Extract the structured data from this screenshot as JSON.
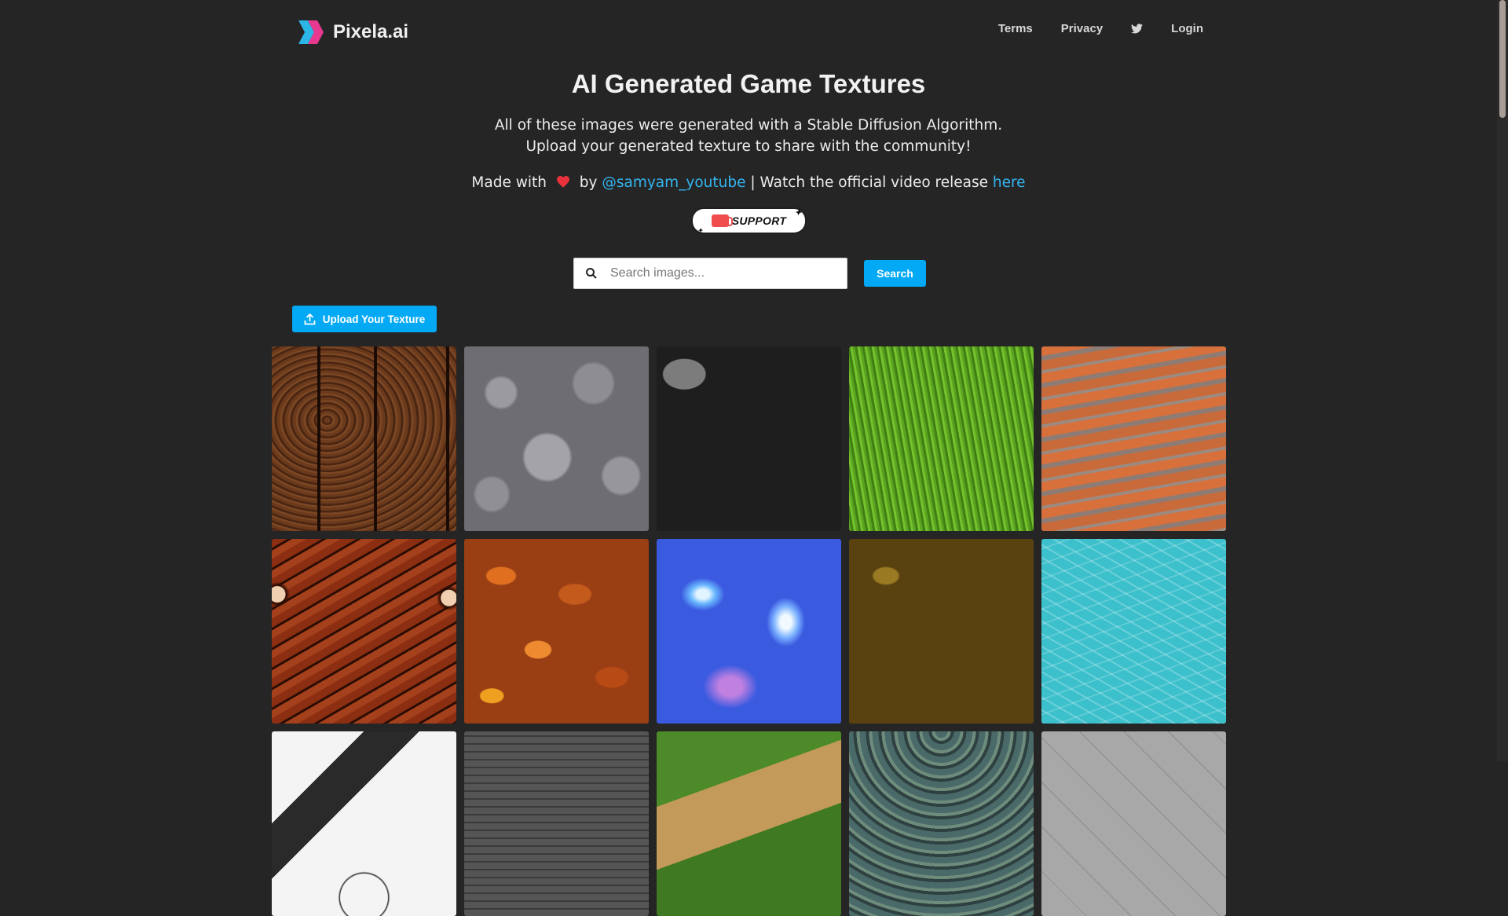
{
  "brand": {
    "name": "Pixela.ai"
  },
  "nav": {
    "terms": "Terms",
    "privacy": "Privacy",
    "login": "Login"
  },
  "hero": {
    "title": "AI Generated Game Textures",
    "description": "All of these images were generated with a Stable Diffusion Algorithm. Upload your generated texture to share with the community!",
    "credit_prefix": "Made with",
    "credit_by": "by",
    "credit_handle": "@samyam_youtube",
    "credit_middle": "| Watch the official video release",
    "credit_link": "here"
  },
  "support": {
    "label": "SUPPORT"
  },
  "search": {
    "placeholder": "Search images...",
    "value": "",
    "button": "Search"
  },
  "upload": {
    "label": "Upload Your Texture"
  },
  "colors": {
    "accent": "#03a9f4",
    "link": "#33b5f0",
    "background": "#252526",
    "heart": "#e8323c"
  },
  "gallery": [
    {
      "texture": "wood-planks"
    },
    {
      "texture": "gray-rock"
    },
    {
      "texture": "stones"
    },
    {
      "texture": "grass"
    },
    {
      "texture": "sand"
    },
    {
      "texture": "owl-bark"
    },
    {
      "texture": "autumn-leaves"
    },
    {
      "texture": "crystal"
    },
    {
      "texture": "dirt"
    },
    {
      "texture": "water"
    },
    {
      "texture": "black-white"
    },
    {
      "texture": "cobblestone"
    },
    {
      "texture": "path"
    },
    {
      "texture": "scales"
    },
    {
      "texture": "tiles"
    }
  ]
}
